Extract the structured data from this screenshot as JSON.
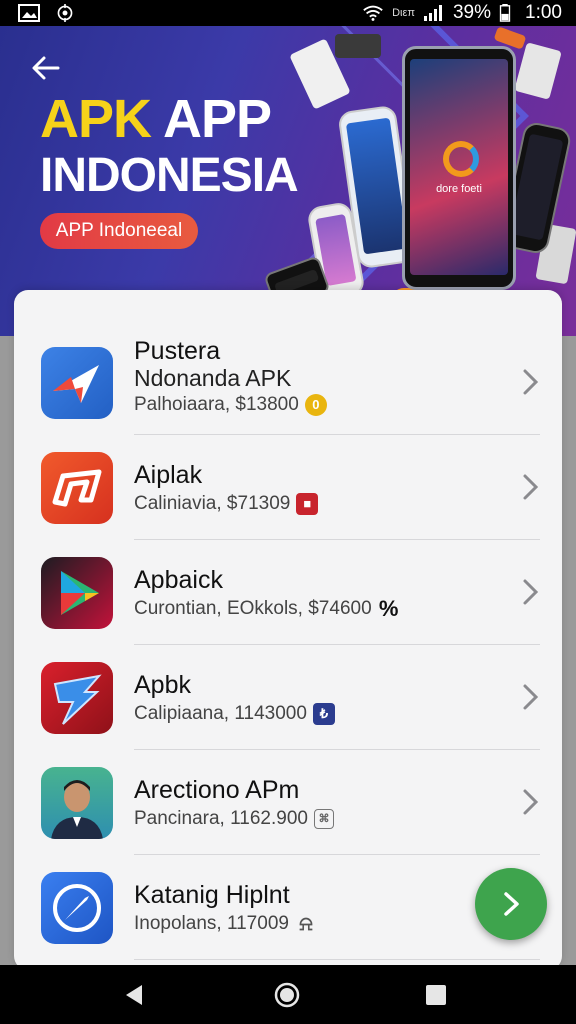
{
  "status_bar": {
    "network_label": "Dιεπ",
    "battery_percent": "39%",
    "time": "1:00"
  },
  "banner": {
    "title_accent": "APK",
    "title_rest": " APP",
    "title_line2": "INDONESIA",
    "pill_label": "APP Indoneeal",
    "phone_label": "dore foeti"
  },
  "apps": [
    {
      "title": "Pustera",
      "subtitle": "Ndonanda APK",
      "meta": "Palhoiaara, $13800",
      "badge": "0",
      "badge_color": "#e9b50f",
      "icon": "paper-plane-icon"
    },
    {
      "title": "Aiplak",
      "subtitle": "",
      "meta": "Caliniavia, $71309",
      "badge": "■",
      "badge_color": "#c8242d",
      "icon": "app-logo-icon"
    },
    {
      "title": "Apbaick",
      "subtitle": "",
      "meta": "Curontian, EOkkols, $74600",
      "badge": "%",
      "badge_color": "#111111",
      "icon": "play-store-icon"
    },
    {
      "title": "Apbk",
      "subtitle": "",
      "meta": "Calipiaana, 1143000",
      "badge": "₺",
      "badge_color": "#2b3c8f",
      "icon": "lightning-icon"
    },
    {
      "title": "Arectiono APm",
      "subtitle": "",
      "meta": "Pancinara, 1162.900",
      "badge": "⌘",
      "badge_color": "#777777",
      "icon": "avatar-icon"
    },
    {
      "title": "Katanig Hiplnt",
      "subtitle": "",
      "meta": "Inopolans, 117009",
      "badge": "⍾",
      "badge_color": "#555555",
      "icon": "compass-icon"
    }
  ],
  "colors": {
    "fab": "#3ea44d",
    "banner_accent": "#f6d21a",
    "pill": "#e23a45"
  }
}
